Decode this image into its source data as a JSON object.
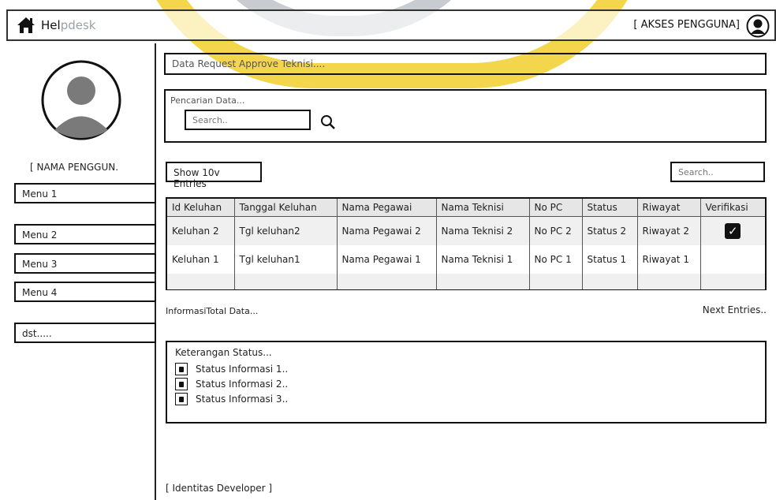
{
  "app": {
    "brand_prefix": "Hel",
    "brand_suffix": "pdesk",
    "user_access": "[ AKSES PENGGUNA]"
  },
  "sidebar": {
    "user_name": "[ NAMA PENGGUN.",
    "menu": [
      {
        "label": "Menu 1"
      },
      {
        "label": "Menu 2"
      },
      {
        "label": "Menu 3"
      },
      {
        "label": "Menu 4"
      },
      {
        "label": "dst....."
      }
    ]
  },
  "main": {
    "section_title": "Data Request Approve Teknisi....",
    "search_panel": {
      "label": "Pencarian Data...",
      "placeholder": "Search.."
    },
    "show_entries": "Show 10v Entries",
    "table_search_placeholder": "Search..",
    "table": {
      "headers": [
        "Id Keluhan",
        "Tanggal Keluhan",
        "Nama Pegawai",
        "Nama Teknisi",
        "No PC",
        "Status",
        "Riwayat",
        "Verifikasi"
      ],
      "rows": [
        [
          "Keluhan 2",
          "Tgl keluhan2",
          "Nama Pegawai 2",
          "Nama Teknisi 2",
          "No PC 2",
          "Status 2",
          "Riwayat 2",
          "✓"
        ],
        [
          "Keluhan 1",
          "Tgl keluhan1",
          "Nama Pegawai 1",
          "Nama Teknisi 1",
          "No PC 1",
          "Status 1",
          "Riwayat 1",
          ""
        ]
      ]
    },
    "info_total": "InformasiTotal Data...",
    "next_entries": "Next Entries..",
    "legend": {
      "title": "Keterangan Status...",
      "items": [
        "Status Informasi 1..",
        "Status Informasi 2..",
        "Status Informasi 3.."
      ]
    },
    "footer": "[ Identitas Developer ]"
  },
  "colors": {
    "accent_watermark": "#f3d23a",
    "watermark_gray": "#bfc3c7"
  }
}
